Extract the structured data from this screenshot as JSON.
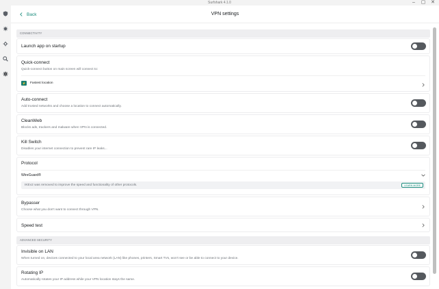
{
  "window": {
    "title": "Surfshark 4.1.0"
  },
  "header": {
    "back_label": "Back",
    "title": "VPN settings"
  },
  "sections": {
    "connectivity": "CONNECTIVITY",
    "advanced": "ADVANCED SECURITY"
  },
  "settings": {
    "launch": {
      "title": "Launch app on startup",
      "enabled": false
    },
    "quick_connect": {
      "title": "Quick-connect",
      "subtitle": "Quick-connect button on main screen will connect to:",
      "option": "Fastest location",
      "option_badge": "⚡"
    },
    "auto_connect": {
      "title": "Auto-connect",
      "subtitle": "Add trusted networks and choose a location to connect automatically.",
      "enabled": false
    },
    "cleanweb": {
      "title": "CleanWeb",
      "subtitle": "Blocks ads, trackers and malware when VPN is connected.",
      "enabled": false
    },
    "kill_switch": {
      "title": "Kill Switch",
      "subtitle": "Disables your internet connection to prevent rare IP leaks...",
      "enabled": false
    },
    "protocol": {
      "title": "Protocol",
      "value": "WireGuard®",
      "notice": "IKEv2 was removed to improve the speed and functionality of other protocols.",
      "learn_more": "LEARN MORE"
    },
    "bypasser": {
      "title": "Bypasser",
      "subtitle": "Choose what you don't want to connect through VPN."
    },
    "speed_test": {
      "title": "Speed test"
    },
    "invisible_lan": {
      "title": "Invisible on LAN",
      "subtitle": "When turned on, devices connected to your local area network (LAN) like phones, printers, Smart TVs, won't see or be able to connect to your device.",
      "enabled": false
    },
    "rotating_ip": {
      "title": "Rotating IP",
      "subtitle": "Automatically rotates your IP address while your VPN location stays the same.",
      "enabled": false
    }
  },
  "sidebar": {
    "icons": [
      "shield-icon",
      "virus-icon",
      "gear-small-icon",
      "search-lock-icon",
      "settings-icon"
    ]
  },
  "colors": {
    "accent": "#178a7b",
    "toggle_off": "#55595e"
  }
}
